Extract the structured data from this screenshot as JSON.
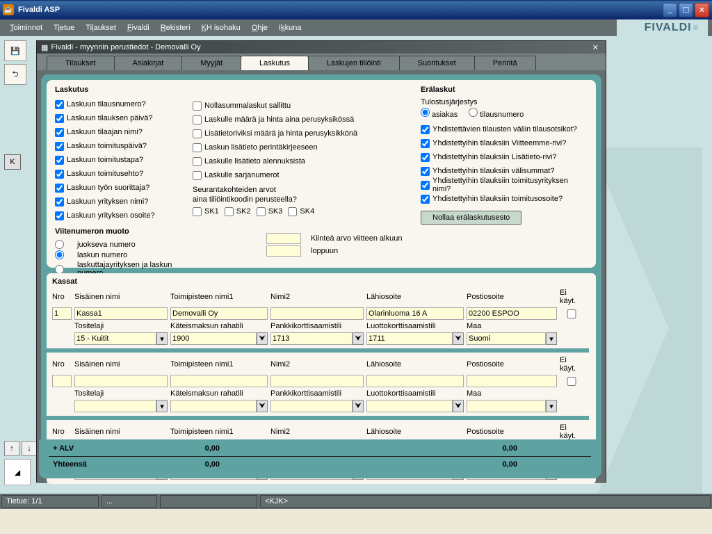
{
  "window": {
    "title": "Fivaldi ASP"
  },
  "brand": "FIVALDI",
  "menubar": [
    "Toiminnot",
    "Tietue",
    "Tilaukset",
    "Fivaldi",
    "Rekisteri",
    "KH isohaku",
    "Ohje",
    "Ikkuna"
  ],
  "subwindow": {
    "title": "Fivaldi - myynnin perustiedot - Demovalli Oy"
  },
  "tabs": [
    "Tilaukset",
    "Asiakirjat",
    "Myyjät",
    "Laskutus",
    "Laskujen tiliöinti",
    "Suoritukset",
    "Perintä"
  ],
  "active_tab": 3,
  "laskutus": {
    "title": "Laskutus",
    "left": [
      "Laskuun tilausnumero?",
      "Laskuun tilauksen päivä?",
      "Laskuun tilaajan nimi?",
      "Laskuun toimituspäivä?",
      "Laskuun toimitustapa?",
      "Laskuun toimitusehto?",
      "Laskuun työn suorittaja?",
      "Laskuun yrityksen nimi?",
      "Laskuun yrityksen osoite?"
    ],
    "mid": [
      "Nollasummalaskut sallittu",
      "Laskulle määrä ja hinta aina perusyksikössä",
      "Lisätietoriviksi määrä ja hinta perusyksikkönä",
      "Laskun lisätieto perintäkirjeeseen",
      "Laskulle lisätieto alennuksista",
      "Laskulle sarjanumerot"
    ],
    "seur1": "Seurantakohteiden arvot",
    "seur2": "aina tiliöintikoodin perusteella?",
    "sk": [
      "SK1",
      "SK2",
      "SK3",
      "SK4"
    ]
  },
  "era": {
    "title": "Erälaskut",
    "sort_label": "Tulostusjärjestys",
    "sort_opts": [
      "asiakas",
      "tilausnumero"
    ],
    "flags": [
      "Yhdistettävien tilausten väliin tilausotsikot?",
      "Yhdistettyihin tilauksiin Viitteemme-rivi?",
      "Yhdistettyihin tilauksiin Lisätieto-rivi?",
      "Yhdistettyihin tilauksiin välisummat?",
      "Yhdistettyihin tilauksiin toimitusyrityksen nimi?",
      "Yhdistettyihin tilauksiin toimitusosoite?"
    ],
    "button": "Nollaa erälaskutusesto"
  },
  "viite": {
    "title": "Viitenumeron muoto",
    "opts": [
      "juokseva numero",
      "laskun numero",
      "laskuttajayrityksen ja laskun numero"
    ],
    "fixedpre": "Kiinteä arvo viitteen alkuun",
    "fixedpost": "loppuun"
  },
  "kassat": {
    "title": "Kassat",
    "headers": {
      "nro": "Nro",
      "sisainen": "Sisäinen nimi",
      "toimi": "Toimipisteen nimi1",
      "nimi2": "Nimi2",
      "lahi": "Lähiosoite",
      "posti": "Postiosoite",
      "eikayt": "Ei käyt.",
      "tositelaji": "Tositelaji",
      "kat": "Käteismaksun rahatili",
      "pankki": "Pankkikorttisaamistili",
      "luotto": "Luottokorttisaamistili",
      "maa": "Maa"
    },
    "row1": {
      "nro": "1",
      "sisainen": "Kassa1",
      "toimi": "Demovalli Oy",
      "nimi2": "",
      "lahi": "Olarinluoma 16 A",
      "posti": "02200 ESPOO",
      "tositelaji": "15 - Kuitit",
      "kat": "1900",
      "pankki": "1713",
      "luotto": "1711",
      "maa": "Suomi"
    }
  },
  "summary": {
    "alv": "+ ALV",
    "alv_v1": "0,00",
    "alv_v2": "0,00",
    "tot": "Yhteensä",
    "tot_v1": "0,00",
    "tot_v2": "0,00"
  },
  "leftbar": {
    "k": "K"
  },
  "status": {
    "tietue": "Tietue: 1/1",
    "dots": "...",
    "user": "<KJK>"
  }
}
